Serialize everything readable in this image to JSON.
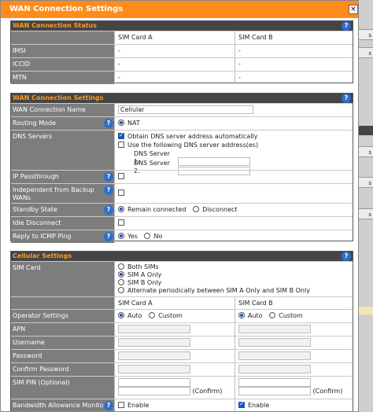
{
  "dialog": {
    "title": "WAN Connection Settings",
    "close": "×"
  },
  "status": {
    "header": "WAN Connection Status",
    "col_a": "SIM Card A",
    "col_b": "SIM Card B",
    "rows": [
      {
        "label": "IMSI",
        "a": "-",
        "b": "-"
      },
      {
        "label": "ICCID",
        "a": "-",
        "b": "-"
      },
      {
        "label": "MTN",
        "a": "-",
        "b": "-"
      }
    ]
  },
  "wan": {
    "header": "WAN Connection Settings",
    "name_label": "WAN Connection Name",
    "name_value": "Cellular",
    "routing_label": "Routing Mode",
    "routing_value": "NAT",
    "dns_label": "DNS Servers",
    "dns_auto": "Obtain DNS server address automatically",
    "dns_manual": "Use the following DNS server address(es)",
    "dns1_label": "DNS Server 1:",
    "dns2_label": "DNS Server 2:",
    "ip_pass_label": "IP Passthrough",
    "indep_label": "Independent from Backup WANs",
    "standby_label": "Standby State",
    "standby_on": "Remain connected",
    "standby_off": "Disconnect",
    "idle_label": "Idle Disconnect",
    "icmp_label": "Reply to ICMP Ping",
    "icmp_yes": "Yes",
    "icmp_no": "No"
  },
  "cell": {
    "header": "Cellular Settings",
    "sim_label": "SIM Card",
    "sim_options": [
      "Both SIMs",
      "SIM A Only",
      "SIM B Only",
      "Alternate periodically between SIM A Only and SIM B Only"
    ],
    "col_a": "SIM Card A",
    "col_b": "SIM Card B",
    "operator_label": "Operator Settings",
    "auto": "Auto",
    "custom": "Custom",
    "apn_label": "APN",
    "user_label": "Username",
    "pass_label": "Password",
    "confirm_label": "Confirm Password",
    "pin_label": "SIM PIN (Optional)",
    "confirm_small": "(Confirm)",
    "bw_label": "Bandwidth Allowance Monitor",
    "enable": "Enable"
  },
  "background": {
    "b1": "s",
    "b2": "s",
    "b3": "s",
    "b4": "s",
    "b5": "s"
  },
  "colors": {
    "title_bar": "#ff8c1a",
    "section_header": "#454545",
    "header_text": "#ff9a1f",
    "label_bg": "#7d7d7d",
    "accent": "#1e55b3",
    "help": "#2f6fc9"
  },
  "icons": [
    "close-icon",
    "help-icon",
    "radio-icon",
    "checkbox-icon"
  ]
}
